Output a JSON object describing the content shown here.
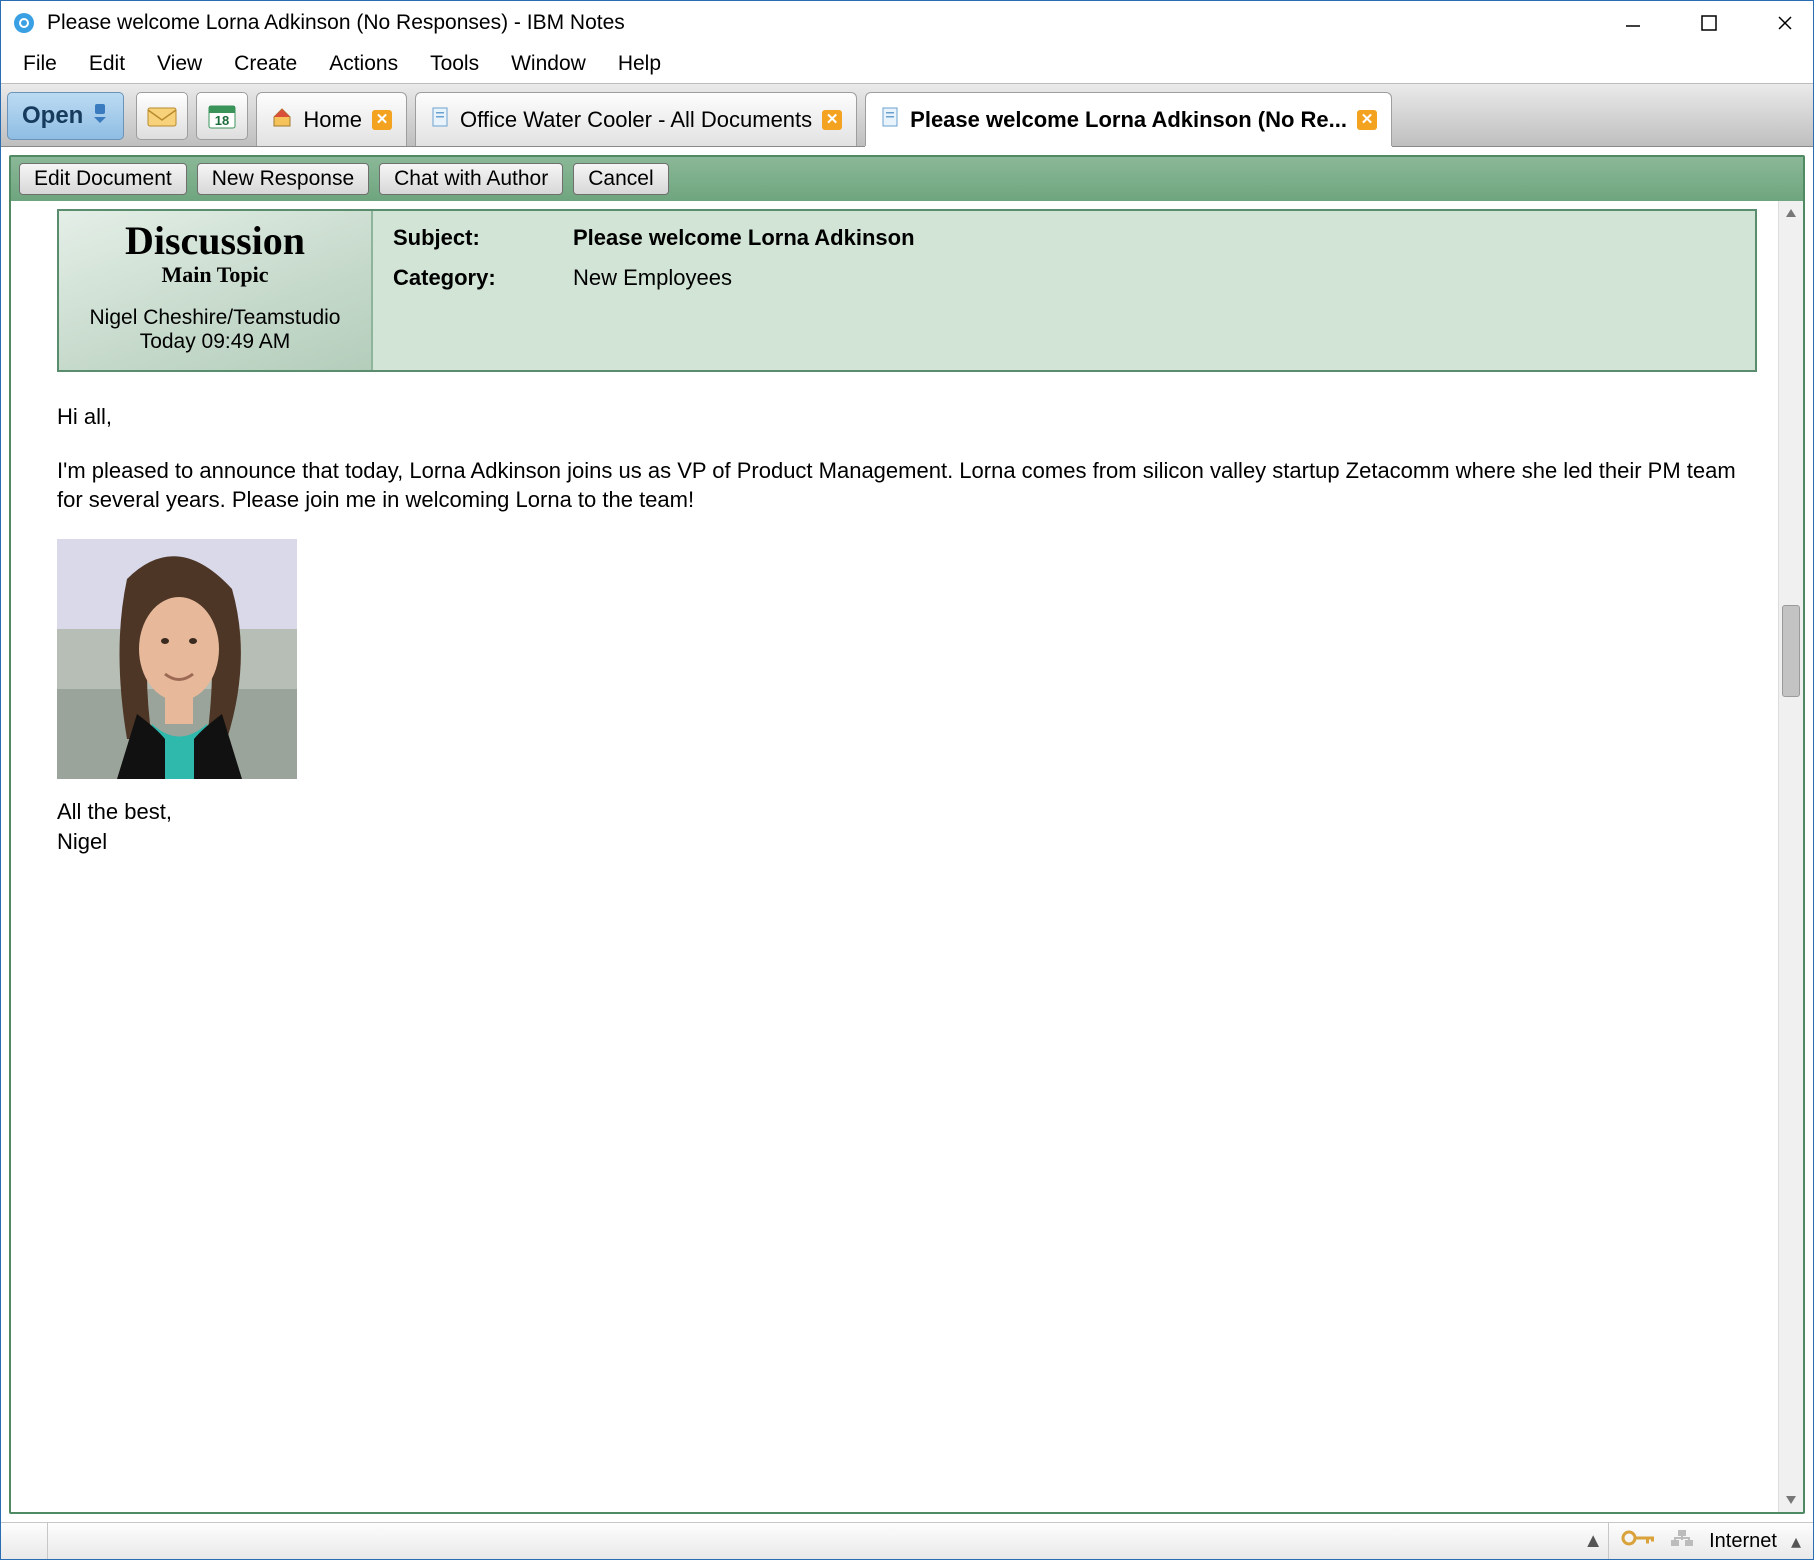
{
  "window": {
    "title": "Please welcome Lorna Adkinson (No Responses) - IBM Notes"
  },
  "menus": [
    "File",
    "Edit",
    "View",
    "Create",
    "Actions",
    "Tools",
    "Window",
    "Help"
  ],
  "open_button_label": "Open",
  "tabs": [
    {
      "label": "Home",
      "icon": "home",
      "closeable": true,
      "active": false
    },
    {
      "label": "Office Water Cooler - All Documents",
      "icon": "document",
      "closeable": true,
      "active": false
    },
    {
      "label": "Please welcome Lorna Adkinson (No Re...",
      "icon": "document",
      "closeable": true,
      "active": true
    }
  ],
  "actions": {
    "edit": "Edit Document",
    "new_response": "New Response",
    "chat": "Chat with Author",
    "cancel": "Cancel"
  },
  "doc_header": {
    "discussion_title": "Discussion",
    "discussion_subtitle": "Main Topic",
    "author": "Nigel Cheshire/Teamstudio",
    "time": "Today 09:49 AM",
    "subject_label": "Subject:",
    "subject_value": "Please welcome Lorna Adkinson",
    "category_label": "Category:",
    "category_value": "New Employees"
  },
  "body": {
    "para1": "Hi all,",
    "para2": "I'm pleased to announce that today, Lorna Adkinson joins us as VP of Product Management. Lorna comes from silicon valley startup Zetacomm where she led their PM team for several years. Please join me in welcoming Lorna to the team!",
    "signoff1": "All the best,",
    "signoff2": "Nigel"
  },
  "status": {
    "network": "Internet"
  },
  "calendar_day": "18"
}
